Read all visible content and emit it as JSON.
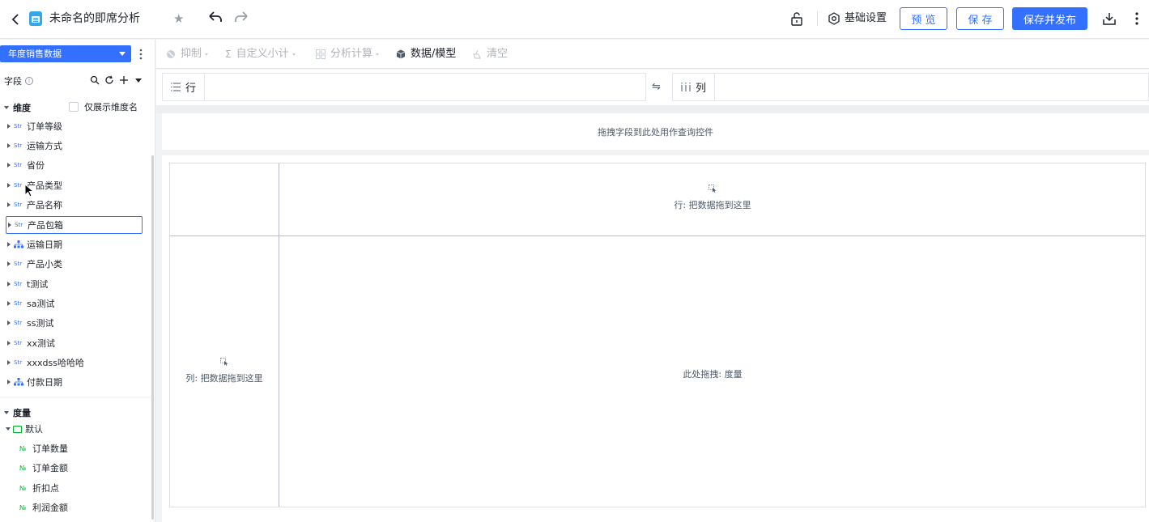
{
  "header": {
    "title": "未命名的即席分析",
    "settings_label": "基础设置",
    "preview_label": "预 览",
    "save_label": "保 存",
    "publish_label": "保存并发布"
  },
  "sidebar": {
    "dataset": "年度销售数据",
    "fields_label": "字段",
    "dimension_group": "维度",
    "only_dim_label": "仅展示维度名",
    "dimensions": [
      {
        "type": "Str",
        "label": "订单等级"
      },
      {
        "type": "Str",
        "label": "运输方式"
      },
      {
        "type": "Str",
        "label": "省份"
      },
      {
        "type": "Str",
        "label": "产品类型"
      },
      {
        "type": "Str",
        "label": "产品名称"
      },
      {
        "type": "Str",
        "label": "产品包箱"
      },
      {
        "type": "hier",
        "label": "运输日期"
      },
      {
        "type": "Str",
        "label": "产品小类"
      },
      {
        "type": "Str",
        "label": "t测试"
      },
      {
        "type": "Str",
        "label": "sa测试"
      },
      {
        "type": "Str",
        "label": "ss测试"
      },
      {
        "type": "Str",
        "label": "xx测试"
      },
      {
        "type": "Str",
        "label": "xxxdss哈哈哈"
      },
      {
        "type": "hier",
        "label": "付款日期"
      }
    ],
    "measure_group": "度量",
    "measure_folder": "默认",
    "measures": [
      {
        "type": "№",
        "label": "订单数量"
      },
      {
        "type": "№",
        "label": "订单金额"
      },
      {
        "type": "№",
        "label": "折扣点"
      },
      {
        "type": "№",
        "label": "利润金额"
      }
    ]
  },
  "toolbar": {
    "suppress": "抑制",
    "subtotal": "自定义小计",
    "analysis": "分析计算",
    "data_model": "数据/模型",
    "clear": "清空"
  },
  "shelf": {
    "rows_label": "行",
    "cols_label": "列",
    "swap_symbol": "⇋"
  },
  "query_hint": "拖拽字段到此处用作查询控件",
  "canvas": {
    "row_hint": "行: 把数据拖到这里",
    "col_hint": "列: 把数据拖到这里",
    "measure_hint": "此处拖拽: 度量"
  },
  "colors": {
    "accent": "#3370ff",
    "measure_green": "#00b42a"
  }
}
